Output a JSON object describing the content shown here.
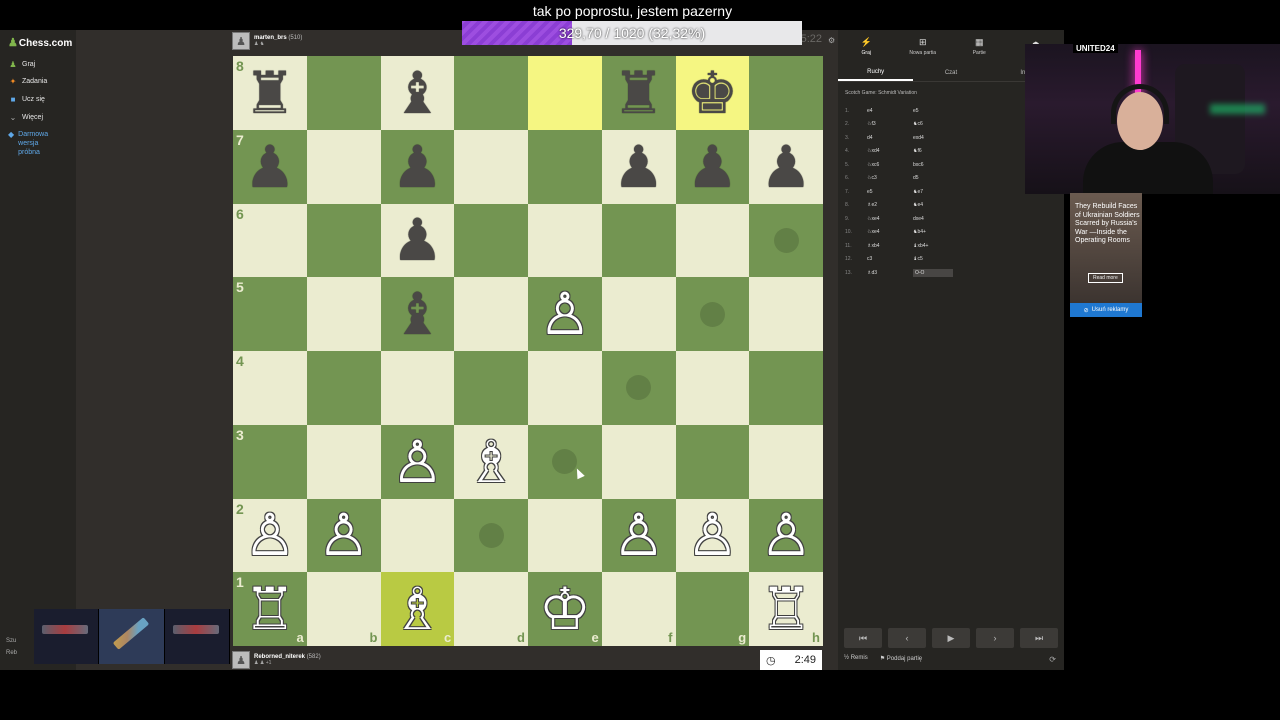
{
  "stream": {
    "title": "tak po poprostu, jestem pazerny",
    "progress_text": "329,70 / 1020 (32,32%)",
    "progress_fraction": 0.3232,
    "accent": "#9d4ee0"
  },
  "sidebar": {
    "logo": "Chess.com",
    "items": [
      {
        "label": "Graj",
        "icon": "pawn-icon"
      },
      {
        "label": "Zadania",
        "icon": "puzzle-icon"
      },
      {
        "label": "Ucz się",
        "icon": "learn-icon"
      },
      {
        "label": "Więcej",
        "icon": "chevron-down-icon"
      }
    ],
    "trial": "Darmowa wersja próbna",
    "bottom": [
      "Szu",
      "Reb"
    ]
  },
  "top_player": {
    "name": "marten_brs",
    "rating": "(510)",
    "clock": "5:22"
  },
  "bottom_player": {
    "name": "Reborned_niterek",
    "rating": "(582)",
    "clock": "2:49"
  },
  "board": {
    "light": "#ebecd0",
    "dark": "#739552",
    "ranks": [
      "8",
      "7",
      "6",
      "5",
      "4",
      "3",
      "2",
      "1"
    ],
    "files": [
      "a",
      "b",
      "c",
      "d",
      "e",
      "f",
      "g",
      "h"
    ],
    "position": [
      [
        "bR",
        "",
        "bB",
        "",
        "",
        "bR",
        "bK",
        ""
      ],
      [
        "bP",
        "",
        "bP",
        "",
        "",
        "bP",
        "bP",
        "bP"
      ],
      [
        "",
        "",
        "bP",
        "",
        "",
        "",
        "",
        ""
      ],
      [
        "",
        "",
        "bB",
        "",
        "wP",
        "",
        "",
        ""
      ],
      [
        "",
        "",
        "",
        "",
        "",
        "",
        "",
        ""
      ],
      [
        "",
        "",
        "wP",
        "wB",
        "",
        "",
        "",
        ""
      ],
      [
        "wP",
        "wP",
        "",
        "",
        "",
        "wP",
        "wP",
        "wP"
      ],
      [
        "wR",
        "",
        "wB",
        "",
        "wK",
        "",
        "",
        "wR"
      ]
    ],
    "highlights": [
      [
        0,
        4
      ],
      [
        0,
        6
      ],
      [
        7,
        2
      ]
    ],
    "move_dots": [
      [
        2,
        7
      ],
      [
        3,
        6
      ],
      [
        4,
        5
      ],
      [
        5,
        4
      ],
      [
        6,
        3
      ]
    ]
  },
  "panel": {
    "tabs": [
      {
        "label": "Graj",
        "icon": "bolt-icon"
      },
      {
        "label": "Nowa partia",
        "icon": "plus-icon"
      },
      {
        "label": "Partie",
        "icon": "grid-icon"
      },
      {
        "label": "",
        "icon": "friends-icon"
      }
    ],
    "subtabs": [
      "Ruchy",
      "Czat",
      "Infor"
    ],
    "opening": "Scotch Game: Schmidt Variation",
    "moves": [
      {
        "n": "1.",
        "w": "e4",
        "b": "e5"
      },
      {
        "n": "2.",
        "w": "♘f3",
        "b": "♞c6"
      },
      {
        "n": "3.",
        "w": "d4",
        "b": "exd4"
      },
      {
        "n": "4.",
        "w": "♘xd4",
        "b": "♞f6"
      },
      {
        "n": "5.",
        "w": "♘xc6",
        "b": "bxc6"
      },
      {
        "n": "6.",
        "w": "♘c3",
        "b": "d5"
      },
      {
        "n": "7.",
        "w": "e5",
        "b": "♞e7"
      },
      {
        "n": "8.",
        "w": "♗e2",
        "b": "♞e4"
      },
      {
        "n": "9.",
        "w": "♘xe4",
        "b": "dxe4"
      },
      {
        "n": "10.",
        "w": "♘xe4",
        "b": "♞b4+"
      },
      {
        "n": "11.",
        "w": "♗xb4",
        "b": "♝xb4+"
      },
      {
        "n": "12.",
        "w": "c3",
        "b": "♝c5"
      },
      {
        "n": "13.",
        "w": "♗d3",
        "b": "O-O"
      }
    ],
    "nav": [
      "⏮",
      "‹",
      "▶",
      "›",
      "⏭"
    ],
    "draw_label": "Remis",
    "resign_label": "Poddaj partię"
  },
  "webcam": {
    "brand": "UNITED24"
  },
  "ad": {
    "text": "They Rebuild Faces of Ukrainian Soldiers Scarred by Russia's War —Inside the Operating Rooms",
    "more": "Read more",
    "remove": "Usuń reklamy"
  },
  "thumbs": [
    "",
    "",
    ""
  ]
}
